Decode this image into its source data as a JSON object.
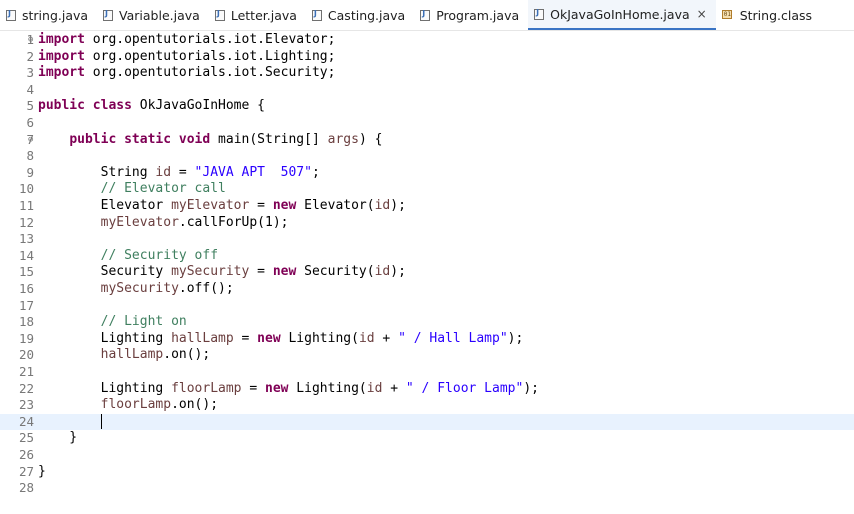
{
  "tabs": [
    {
      "label": "string.java",
      "icon": "java-file-icon",
      "active": false
    },
    {
      "label": "Variable.java",
      "icon": "java-file-icon",
      "active": false
    },
    {
      "label": "Letter.java",
      "icon": "java-file-icon",
      "active": false
    },
    {
      "label": "Casting.java",
      "icon": "java-file-icon",
      "active": false
    },
    {
      "label": "Program.java",
      "icon": "java-file-icon",
      "active": false
    },
    {
      "label": "OkJavaGoInHome.java",
      "icon": "java-file-icon",
      "active": true,
      "close": "×"
    },
    {
      "label": "String.class",
      "icon": "class-file-icon",
      "active": false
    }
  ],
  "editor": {
    "current_line": 24,
    "cursor_line": 24,
    "colors": {
      "keyword": "#7f0055",
      "string": "#2a00ff",
      "comment": "#3f7f5f",
      "variable": "#6a3e3e",
      "current_line_bg": "#e8f2fe",
      "active_tab_border": "#3a74c4"
    },
    "lines": [
      {
        "n": "1",
        "fold": "⊖",
        "segs": [
          {
            "t": "import",
            "c": "kw"
          },
          {
            "t": " org.opentutorials.iot.Elevator;"
          }
        ]
      },
      {
        "n": "2",
        "segs": [
          {
            "t": "import",
            "c": "kw"
          },
          {
            "t": " org.opentutorials.iot.Lighting;"
          }
        ]
      },
      {
        "n": "3",
        "segs": [
          {
            "t": "import",
            "c": "kw"
          },
          {
            "t": " org.opentutorials.iot.Security;"
          }
        ]
      },
      {
        "n": "4",
        "segs": []
      },
      {
        "n": "5",
        "segs": [
          {
            "t": "public",
            "c": "kw"
          },
          {
            "t": " "
          },
          {
            "t": "class",
            "c": "kw"
          },
          {
            "t": " OkJavaGoInHome {"
          }
        ]
      },
      {
        "n": "6",
        "segs": []
      },
      {
        "n": "7",
        "fold": "⊖",
        "segs": [
          {
            "t": "    "
          },
          {
            "t": "public",
            "c": "kw"
          },
          {
            "t": " "
          },
          {
            "t": "static",
            "c": "kw"
          },
          {
            "t": " "
          },
          {
            "t": "void",
            "c": "kw"
          },
          {
            "t": " main(String[] "
          },
          {
            "t": "args",
            "c": "var"
          },
          {
            "t": ") {"
          }
        ]
      },
      {
        "n": "8",
        "segs": []
      },
      {
        "n": "9",
        "segs": [
          {
            "t": "        String "
          },
          {
            "t": "id",
            "c": "var"
          },
          {
            "t": " = "
          },
          {
            "t": "\"JAVA APT  507\"",
            "c": "str"
          },
          {
            "t": ";"
          }
        ]
      },
      {
        "n": "10",
        "segs": [
          {
            "t": "        "
          },
          {
            "t": "// Elevator call",
            "c": "cmt"
          }
        ]
      },
      {
        "n": "11",
        "segs": [
          {
            "t": "        Elevator "
          },
          {
            "t": "myElevator",
            "c": "var"
          },
          {
            "t": " = "
          },
          {
            "t": "new",
            "c": "kw"
          },
          {
            "t": " Elevator("
          },
          {
            "t": "id",
            "c": "var"
          },
          {
            "t": ");"
          }
        ]
      },
      {
        "n": "12",
        "segs": [
          {
            "t": "        "
          },
          {
            "t": "myElevator",
            "c": "var"
          },
          {
            "t": ".callForUp(1);"
          }
        ]
      },
      {
        "n": "13",
        "segs": []
      },
      {
        "n": "14",
        "segs": [
          {
            "t": "        "
          },
          {
            "t": "// Security off",
            "c": "cmt"
          }
        ]
      },
      {
        "n": "15",
        "segs": [
          {
            "t": "        Security "
          },
          {
            "t": "mySecurity",
            "c": "var"
          },
          {
            "t": " = "
          },
          {
            "t": "new",
            "c": "kw"
          },
          {
            "t": " Security("
          },
          {
            "t": "id",
            "c": "var"
          },
          {
            "t": ");"
          }
        ]
      },
      {
        "n": "16",
        "segs": [
          {
            "t": "        "
          },
          {
            "t": "mySecurity",
            "c": "var"
          },
          {
            "t": ".off();"
          }
        ]
      },
      {
        "n": "17",
        "segs": []
      },
      {
        "n": "18",
        "segs": [
          {
            "t": "        "
          },
          {
            "t": "// Light on",
            "c": "cmt"
          }
        ]
      },
      {
        "n": "19",
        "segs": [
          {
            "t": "        Lighting "
          },
          {
            "t": "hallLamp",
            "c": "var"
          },
          {
            "t": " = "
          },
          {
            "t": "new",
            "c": "kw"
          },
          {
            "t": " Lighting("
          },
          {
            "t": "id",
            "c": "var"
          },
          {
            "t": " + "
          },
          {
            "t": "\" / Hall Lamp\"",
            "c": "str"
          },
          {
            "t": ");"
          }
        ]
      },
      {
        "n": "20",
        "segs": [
          {
            "t": "        "
          },
          {
            "t": "hallLamp",
            "c": "var"
          },
          {
            "t": ".on();"
          }
        ]
      },
      {
        "n": "21",
        "segs": []
      },
      {
        "n": "22",
        "segs": [
          {
            "t": "        Lighting "
          },
          {
            "t": "floorLamp",
            "c": "var"
          },
          {
            "t": " = "
          },
          {
            "t": "new",
            "c": "kw"
          },
          {
            "t": " Lighting("
          },
          {
            "t": "id",
            "c": "var"
          },
          {
            "t": " + "
          },
          {
            "t": "\" / Floor Lamp\"",
            "c": "str"
          },
          {
            "t": ");"
          }
        ]
      },
      {
        "n": "23",
        "segs": [
          {
            "t": "        "
          },
          {
            "t": "floorLamp",
            "c": "var"
          },
          {
            "t": ".on();"
          }
        ]
      },
      {
        "n": "24",
        "segs": [
          {
            "t": "        "
          }
        ]
      },
      {
        "n": "25",
        "segs": [
          {
            "t": "    }"
          }
        ]
      },
      {
        "n": "26",
        "segs": []
      },
      {
        "n": "27",
        "segs": [
          {
            "t": "}"
          }
        ]
      },
      {
        "n": "28",
        "segs": []
      }
    ]
  }
}
